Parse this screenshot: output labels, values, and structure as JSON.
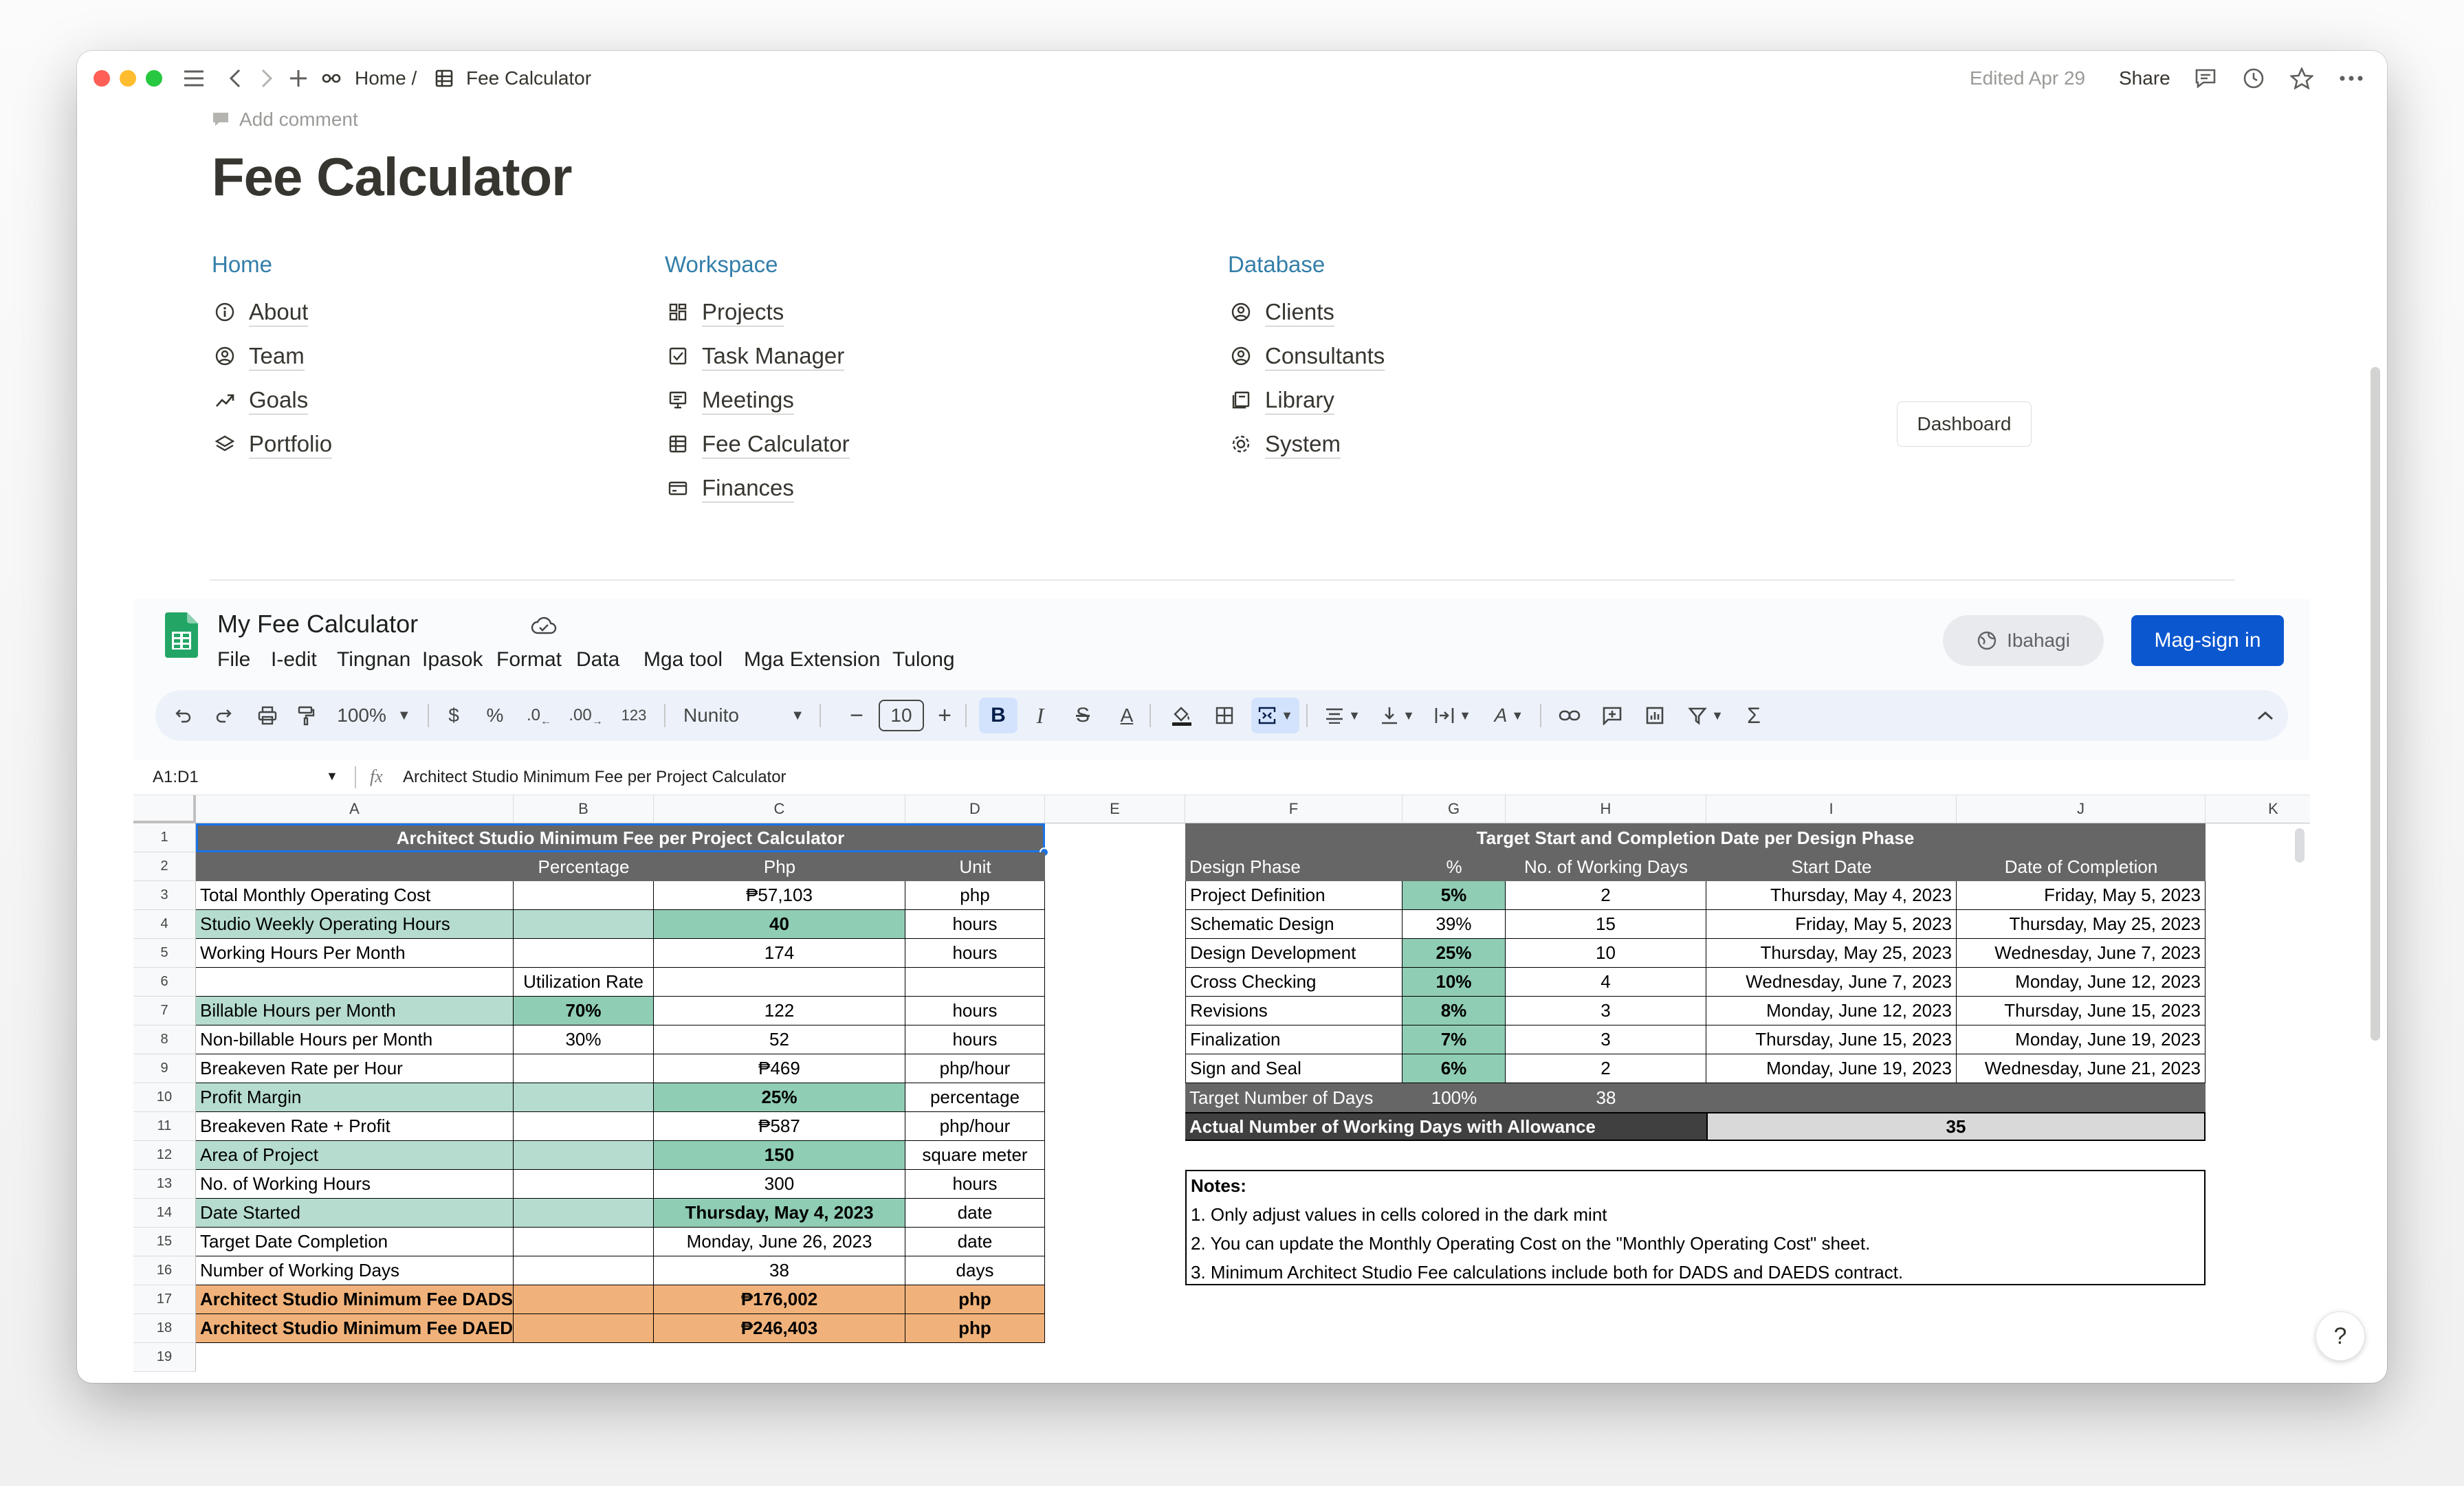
{
  "topbar": {
    "home": "Home /",
    "page": "Fee Calculator",
    "edited": "Edited Apr 29",
    "share": "Share"
  },
  "page": {
    "add_comment": "Add comment",
    "title": "Fee Calculator",
    "dashboard_button": "Dashboard"
  },
  "nav": {
    "home": {
      "heading": "Home",
      "items": [
        "About",
        "Team",
        "Goals",
        "Portfolio"
      ]
    },
    "workspace": {
      "heading": "Workspace",
      "items": [
        "Projects",
        "Task Manager",
        "Meetings",
        "Fee Calculator",
        "Finances"
      ]
    },
    "database": {
      "heading": "Database",
      "items": [
        "Clients",
        "Consultants",
        "Library",
        "System"
      ]
    }
  },
  "sheets": {
    "title": "My Fee Calculator",
    "menu": [
      "File",
      "I-edit",
      "Tingnan",
      "Ipasok",
      "Format",
      "Data",
      "Mga tool",
      "Mga Extension",
      "Tulong"
    ],
    "sign_pill": "Ibahagi",
    "sign_in": "Mag-sign in",
    "toolbar": {
      "zoom": "100%",
      "currency": "$",
      "percent": "%",
      "dec_less": ".0",
      "dec_more": ".00",
      "num_format": "123",
      "font": "Nunito",
      "font_size": "10"
    },
    "name_box": "A1:D1",
    "formula": "Architect Studio Minimum Fee per Project Calculator"
  },
  "columns": [
    "A",
    "B",
    "C",
    "D",
    "E",
    "F",
    "G",
    "H",
    "I",
    "J",
    "K"
  ],
  "rows": [
    "1",
    "2",
    "3",
    "4",
    "5",
    "6",
    "7",
    "8",
    "9",
    "10",
    "11",
    "12",
    "13",
    "14",
    "15",
    "16",
    "17",
    "18",
    "19"
  ],
  "left_table": {
    "title": "Architect Studio Minimum Fee per Project Calculator",
    "headers": [
      "Percentage",
      "Php",
      "Unit"
    ],
    "rows": [
      [
        "Total Monthly Operating Cost",
        "",
        "₱57,103",
        "php"
      ],
      [
        "Studio Weekly Operating Hours",
        "",
        "40",
        "hours"
      ],
      [
        "Working Hours Per Month",
        "",
        "174",
        "hours"
      ],
      [
        "",
        "Utilization Rate",
        "",
        ""
      ],
      [
        "Billable Hours per Month",
        "70%",
        "122",
        "hours"
      ],
      [
        "Non-billable Hours per Month",
        "30%",
        "52",
        "hours"
      ],
      [
        "Breakeven Rate per Hour",
        "",
        "₱469",
        "php/hour"
      ],
      [
        "Profit Margin",
        "",
        "25%",
        "percentage"
      ],
      [
        "Breakeven Rate + Profit",
        "",
        "₱587",
        "php/hour"
      ],
      [
        "Area of Project",
        "",
        "150",
        "square meter"
      ],
      [
        "No. of Working Hours",
        "",
        "300",
        "hours"
      ],
      [
        "Date Started",
        "",
        "Thursday, May 4, 2023",
        "date"
      ],
      [
        "Target Date Completion",
        "",
        "Monday, June 26, 2023",
        "date"
      ],
      [
        "Number of Working Days",
        "",
        "38",
        "days"
      ],
      [
        "Architect Studio Minimum Fee DADS",
        "",
        "₱176,002",
        "php"
      ],
      [
        "Architect Studio Minimum Fee DAEDS",
        "",
        "₱246,403",
        "php"
      ]
    ]
  },
  "right_table": {
    "title": "Target Start and Completion Date per Design Phase",
    "headers": [
      "Design Phase",
      "%",
      "No. of Working Days",
      "Start Date",
      "Date of Completion"
    ],
    "rows": [
      [
        "Project Definition",
        "5%",
        "2",
        "Thursday, May 4, 2023",
        "Friday, May 5, 2023"
      ],
      [
        "Schematic Design",
        "39%",
        "15",
        "Friday, May 5, 2023",
        "Thursday, May 25, 2023"
      ],
      [
        "Design Development",
        "25%",
        "10",
        "Thursday, May 25, 2023",
        "Wednesday, June 7, 2023"
      ],
      [
        "Cross Checking",
        "10%",
        "4",
        "Wednesday, June 7, 2023",
        "Monday, June 12, 2023"
      ],
      [
        "Revisions",
        "8%",
        "3",
        "Monday, June 12, 2023",
        "Thursday, June 15, 2023"
      ],
      [
        "Finalization",
        "7%",
        "3",
        "Thursday, June 15, 2023",
        "Monday, June 19, 2023"
      ],
      [
        "Sign and Seal",
        "6%",
        "2",
        "Monday, June 19, 2023",
        "Wednesday, June 21, 2023"
      ]
    ],
    "target_row": [
      "Target Number of Days",
      "100%",
      "38"
    ],
    "actual_row": [
      "Actual Number of Working Days with Allowance",
      "35"
    ]
  },
  "notes": {
    "title": "Notes:",
    "lines": [
      "1. Only adjust values in cells colored in the dark mint",
      "2. You can update the Monthly Operating Cost on the \"Monthly Operating Cost\" sheet.",
      "3. Minimum Architect Studio Fee calculations include both for DADS and DAEDS contract."
    ]
  },
  "help": "?"
}
